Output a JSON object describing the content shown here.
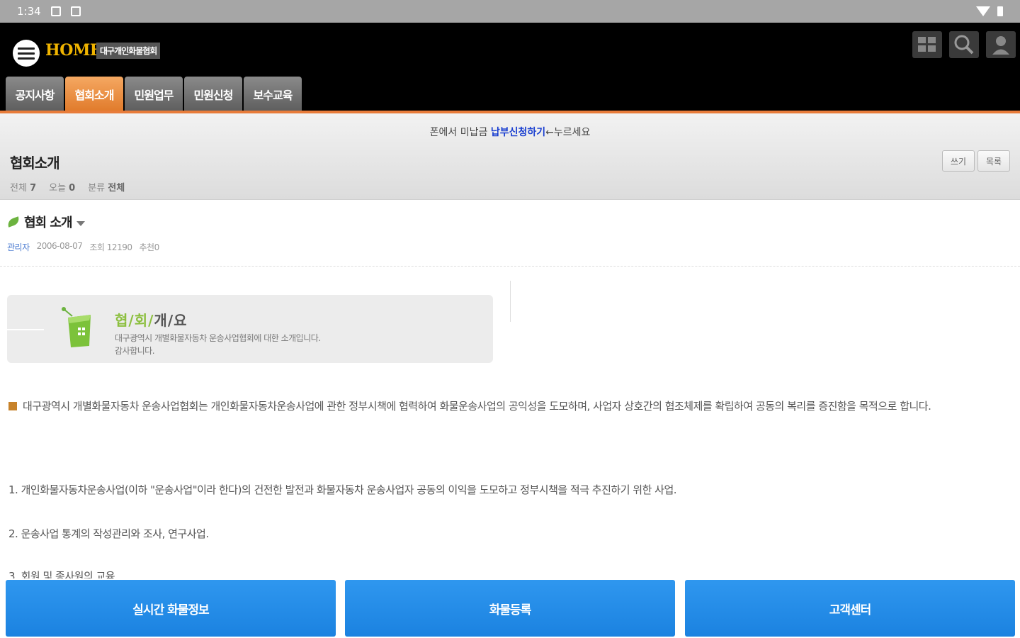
{
  "status_bar": {
    "time": "1:34"
  },
  "header": {
    "home_label": "HOME",
    "assoc_name": "대구개인화물협회",
    "tabs": [
      {
        "label": "공지사항",
        "active": false
      },
      {
        "label": "협회소개",
        "active": true
      },
      {
        "label": "민원업무",
        "active": false
      },
      {
        "label": "민원신청",
        "active": false
      },
      {
        "label": "보수교육",
        "active": false
      }
    ]
  },
  "notice": {
    "prefix": "폰에서 미납금 ",
    "highlight": "납부신청하기",
    "suffix": "←누르세요"
  },
  "board": {
    "title": "협회소개",
    "stats": {
      "total_label": "전체",
      "total": "7",
      "today_label": "오늘",
      "today": "0",
      "category_label": "분류",
      "category": "전체"
    },
    "buttons": {
      "write": "쓰기",
      "list": "목록"
    }
  },
  "post": {
    "title": "협회 소개",
    "author": "관리자",
    "date": "2006-08-07",
    "views_label": "조회",
    "views": "12190",
    "recommend_label": "추천",
    "recommend": "0"
  },
  "intro": {
    "title_green": "협/회/",
    "title_dark": "개/요",
    "desc_line1": "대구광역시 개별화물자동차 운송사업협회에 대한 소개입니다.",
    "desc_line2": "감사합니다."
  },
  "content": {
    "para1": "대구광역시 개별화물자동차 운송사업협회는 개인화물자동차운송사업에 관한 정부시책에 협력하여 화물운송사업의 공익성을 도모하며, 사업자 상호간의 협조체제를 확립하여 공동의 복리를 증진함을 목적으로 합니다.",
    "item1": "1. 개인화물자동차운송사업(이하 \"운송사업\"이라 한다)의 건전한 발전과 화물자동차 운송사업자 공동의 이익을 도모하고 정부시책을 적극 추진하기 위한 사업.",
    "item2": "2. 운송사업 통계의 작성관리와 조사, 연구사업.",
    "item3": "3. 회원 및 종사원의 교육"
  },
  "bottom_buttons": {
    "realtime": "실시간 화물정보",
    "register": "화물등록",
    "support": "고객센터"
  },
  "colors": {
    "accent_orange": "#e87c3a",
    "button_blue": "#1b82e0",
    "home_gold": "#f0b400",
    "intro_green": "#8cbf3f"
  }
}
